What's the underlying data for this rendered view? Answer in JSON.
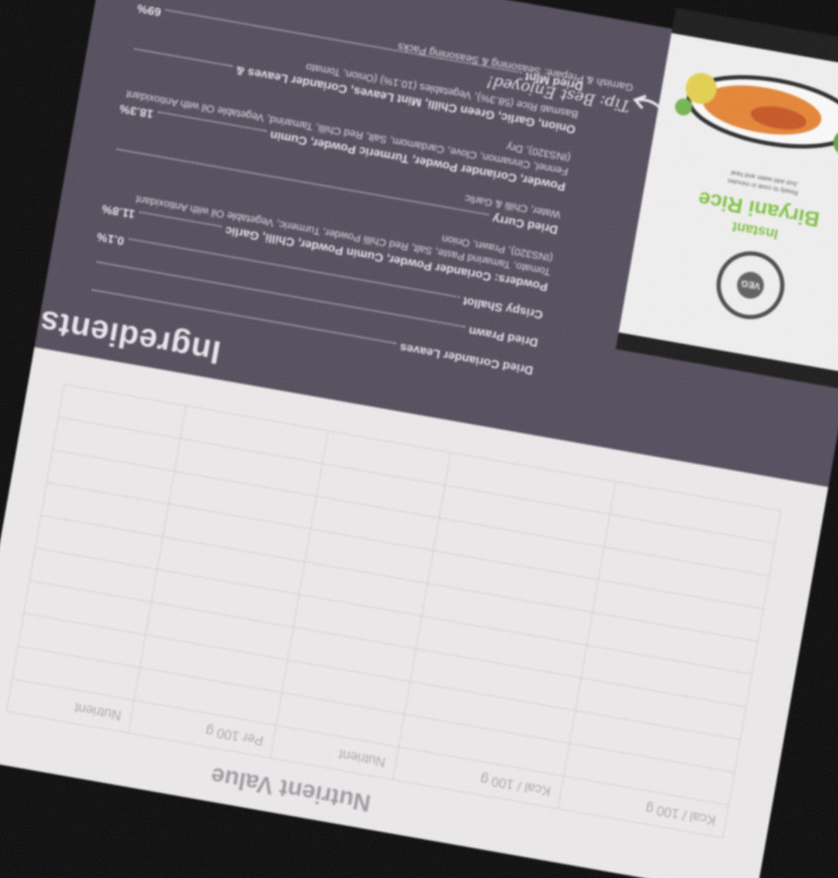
{
  "nutrient": {
    "title": "Nutrient Value",
    "headers": [
      "Kcal / 100 g",
      "Kcal / 100 g",
      "Nutrient",
      "Per 100 g",
      "Nutrient"
    ],
    "rows": [
      [
        "",
        "",
        "",
        "",
        ""
      ],
      [
        "",
        "",
        "",
        "",
        ""
      ],
      [
        "",
        "",
        "",
        "",
        ""
      ],
      [
        "",
        "",
        "",
        "",
        ""
      ],
      [
        "",
        "",
        "",
        "",
        ""
      ],
      [
        "",
        "",
        "",
        "",
        ""
      ],
      [
        "",
        "",
        "",
        "",
        ""
      ],
      [
        "",
        "",
        "",
        "",
        ""
      ],
      [
        "",
        "",
        "",
        "",
        ""
      ]
    ]
  },
  "ingredients": {
    "title": "Ingredients",
    "items": [
      {
        "name": "Dried Coriander Leaves",
        "pct": "",
        "desc": ""
      },
      {
        "name": "Dried Prawn",
        "pct": "",
        "desc": ""
      },
      {
        "name": "Crispy Shallot",
        "pct": "0.1%",
        "desc": ""
      },
      {
        "name": "Powders: Coriander Powder, Cumin Powder, Chilli, Garlic",
        "pct": "11.8%",
        "desc": "Tomato, Tamarind Paste, Salt, Red Chilli Powder, Turmeric, Vegetable Oil with Antioxidant (INS320), Prawn, Onion"
      },
      {
        "name": "Dried Curry",
        "pct": "",
        "desc": "Water, Chilli & Garlic"
      },
      {
        "name": "Powder, Coriander Powder, Turmeric Powder, Cumin",
        "pct": "18.3%",
        "desc": "Fennel, Cinnamon, Clove, Cardamom, Salt, Red Chilli, Tamarind, Vegetable Oil with Antioxidant (INS320), Dry"
      },
      {
        "name": "Onion, Garlic, Green Chilli, Mint Leaves, Coriander Leaves &",
        "pct": "",
        "desc": "Basmati Rice (58.3%), Vegetables (10.1%) (Onion, Tomato"
      },
      {
        "name": "Dried Mint",
        "pct": "69%",
        "desc": ""
      }
    ],
    "tip_label": "Tip: Best Enjoyed!",
    "extras_note": "Garnish & Prepare: Seasoning & Seasoning Packs"
  },
  "pack": {
    "brand": "Instant",
    "product": "Biryani Rice",
    "badge_text": "VEG",
    "desc_lines": [
      "Ready to cook in minutes",
      "Just add water and heat"
    ]
  }
}
